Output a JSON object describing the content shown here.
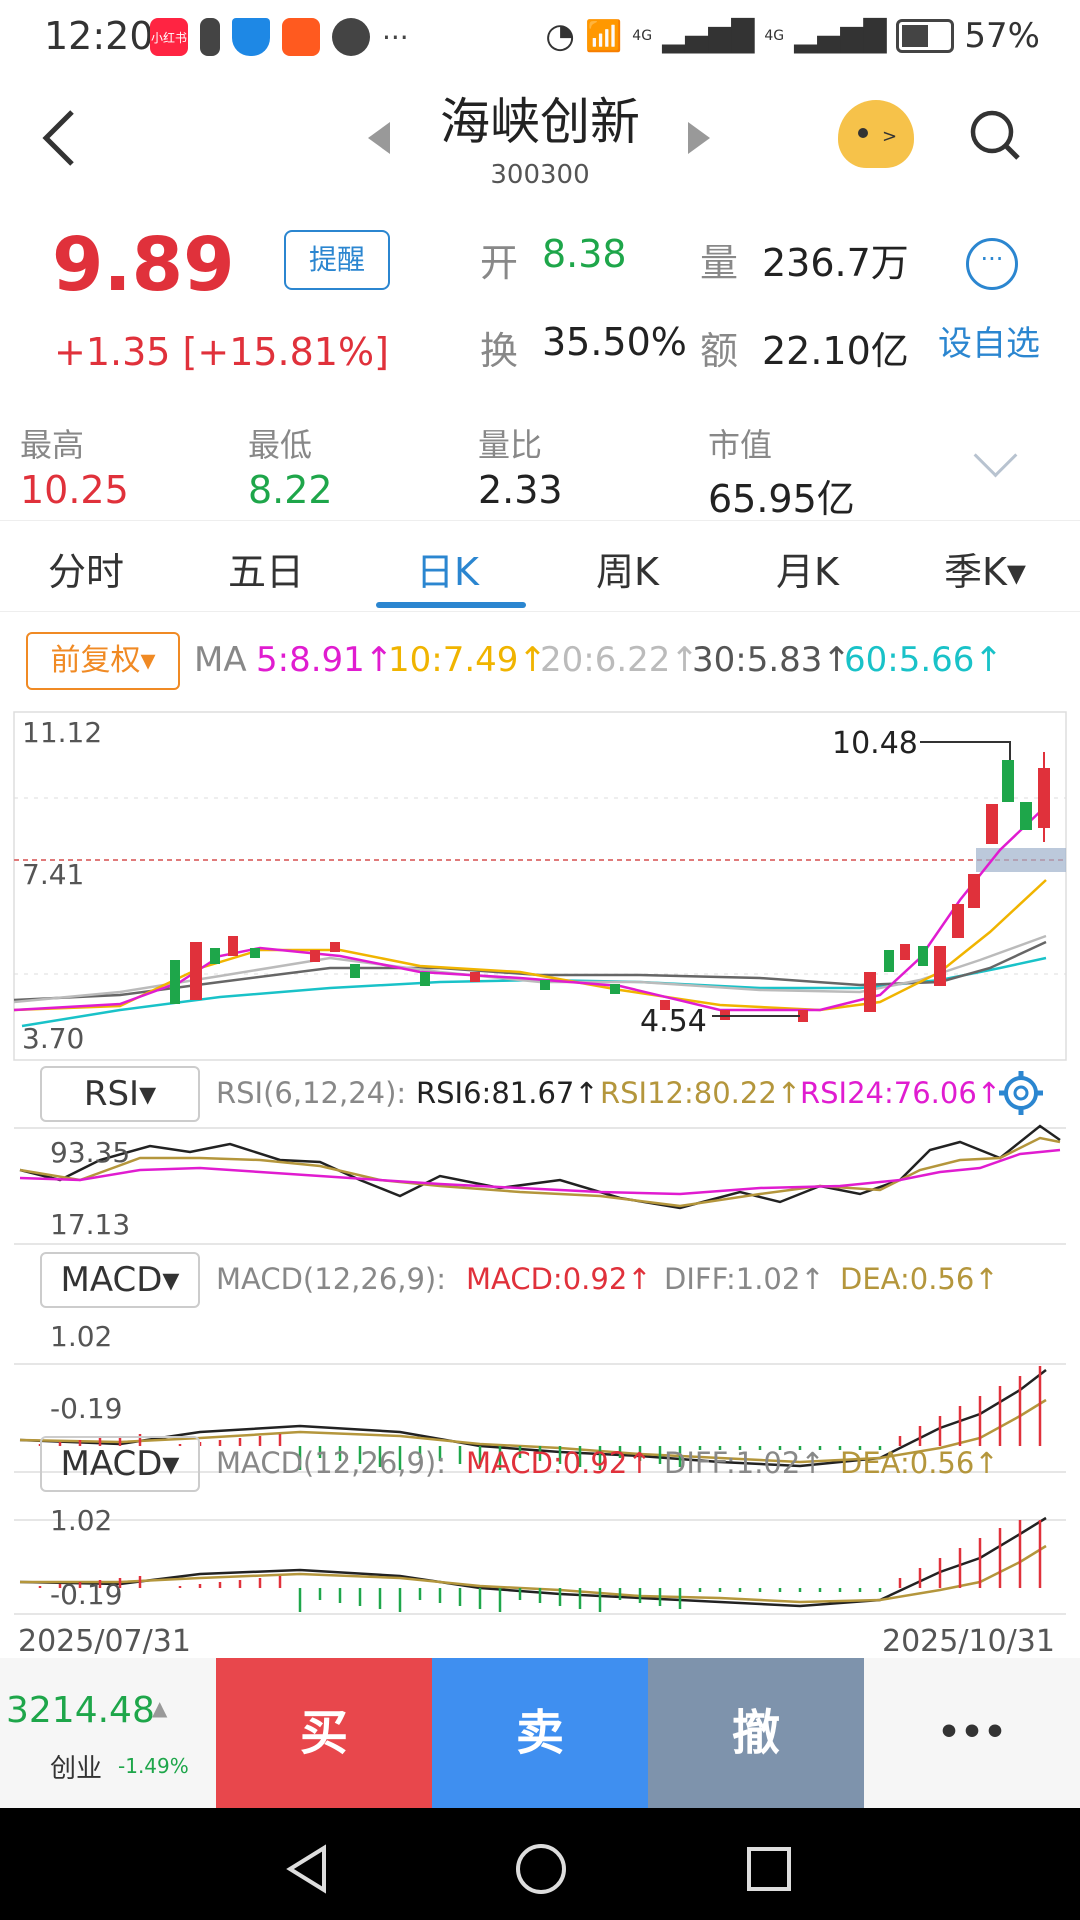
{
  "status_bar": {
    "time": "12:20",
    "app_badge": "小红书",
    "network_4g_1": "4G",
    "network_4g_2": "4G",
    "battery_pct": "57%"
  },
  "header": {
    "stock_name": "海峡创新",
    "stock_code": "300300"
  },
  "quote": {
    "price": "9.89",
    "change": "+1.35 [+15.81%]",
    "remind_label": "提醒",
    "open_label": "开",
    "open_value": "8.38",
    "volume_label": "量",
    "volume_value": "236.7万",
    "turnover_label": "换",
    "turnover_value": "35.50%",
    "amount_label": "额",
    "amount_value": "22.10亿",
    "add_watch_label": "设自选"
  },
  "stats": [
    {
      "label": "最高",
      "value": "10.25",
      "color": "#e0313b"
    },
    {
      "label": "最低",
      "value": "8.22",
      "color": "#1ea64a"
    },
    {
      "label": "量比",
      "value": "2.33",
      "color": "#222222"
    },
    {
      "label": "市值",
      "value": "65.95亿",
      "color": "#222222"
    }
  ],
  "tabs": [
    "分时",
    "五日",
    "日K",
    "周K",
    "月K",
    "季K▾"
  ],
  "active_tab": "日K",
  "ma_row": {
    "adjust_label": "前复权",
    "ma_label": "MA",
    "ma5": "5:8.91↑",
    "ma10": "10:7.49↑",
    "ma20": "20:6.22↑",
    "ma30": "30:5.83↑",
    "ma60": "60:5.66↑"
  },
  "kline": {
    "y_max": "11.12",
    "y_mid": "7.41",
    "y_min": "3.70",
    "high_mark": "10.48",
    "low_mark": "4.54"
  },
  "rsi": {
    "button": "RSI▾",
    "params": "RSI(6,12,24):",
    "rsi6": "RSI6:81.67↑",
    "rsi12": "RSI12:80.22↑",
    "rsi24": "RSI24:76.06↑",
    "y_max": "93.35",
    "y_min": "17.13"
  },
  "macd1": {
    "button": "MACD▾",
    "params": "MACD(12,26,9):",
    "macd": "MACD:0.92↑",
    "diff": "DIFF:1.02↑",
    "dea": "DEA:0.56↑",
    "y_max": "1.02",
    "y_min": "-0.19"
  },
  "macd2": {
    "button": "MACD▾",
    "params": "MACD(12,26,9):",
    "macd": "MACD:0.92↑",
    "diff": "DIFF:1.02↑",
    "dea": "DEA:0.56↑",
    "y_max": "1.02",
    "y_min": "-0.19"
  },
  "date_axis": {
    "start": "2025/07/31",
    "end": "2025/10/31"
  },
  "bottom_bar": {
    "index_value": "3214.48",
    "index_name": "创业",
    "index_change": "-1.49%",
    "buy": "买",
    "sell": "卖",
    "cancel": "撤",
    "more": "•••"
  },
  "colors": {
    "up": "#e0313b",
    "down": "#1ea64a",
    "accent": "#2b86d0",
    "ma5": "#e01cd0",
    "ma10": "#f0b400",
    "ma20": "#bbbbbb",
    "ma30": "#666666",
    "ma60": "#19c2c8"
  }
}
